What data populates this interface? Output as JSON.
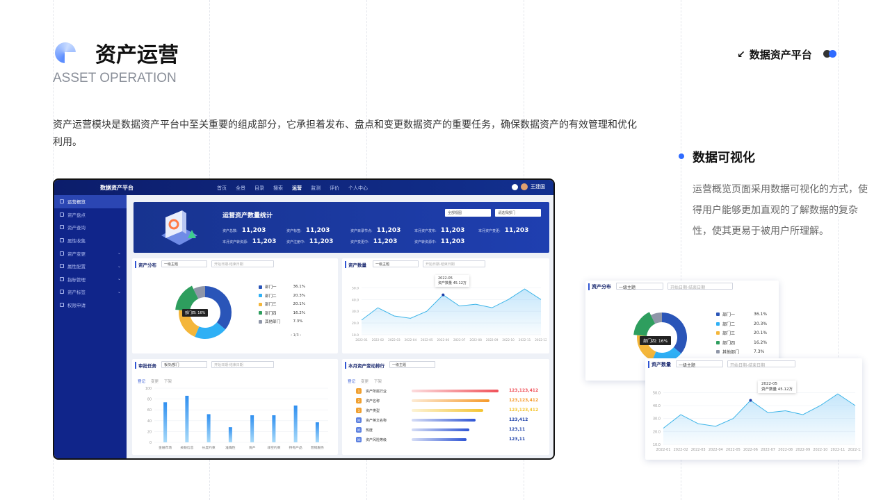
{
  "header": {
    "title": "资产运营",
    "subtitle": "ASSET OPERATION",
    "description": "资产运营模块是数据资产平台中至关重要的组成部分，它承担着发布、盘点和变更数据资产的重要任务，确保数据资产的有效管理和优化利用。",
    "brand_arrow": "↙",
    "brand": "数据资产平台",
    "dot_colors": [
      "#333333",
      "#2f6bff"
    ]
  },
  "visualization": {
    "title": "数据可视化",
    "description": "运营概览页面采用数据可视化的方式，使得用户能够更加直观的了解数据的复杂性，使其更易于被用户所理解。"
  },
  "app": {
    "name": "数据资产平台",
    "nav": [
      "首页",
      "全景",
      "目录",
      "搜索",
      "运营",
      "监测",
      "评价",
      "个人中心"
    ],
    "nav_active": 4,
    "user": "王建国",
    "sidebar": [
      {
        "label": "运营概览",
        "active": true,
        "chev": ""
      },
      {
        "label": "资产盘点",
        "chev": ""
      },
      {
        "label": "资产查询",
        "chev": ""
      },
      {
        "label": "属性收集",
        "chev": ""
      },
      {
        "label": "资产变更",
        "chev": "⌄"
      },
      {
        "label": "属性配置",
        "chev": "⌄"
      },
      {
        "label": "指标管理",
        "chev": "⌄"
      },
      {
        "label": "资产标签",
        "chev": "⌄"
      },
      {
        "label": "权限申请",
        "chev": ""
      }
    ],
    "banner": {
      "title": "运营资产数量统计",
      "select1": "全部视图",
      "select2": "请选择部门",
      "stats": [
        {
          "label": "资产总数:",
          "value": "11,203"
        },
        {
          "label": "资产标签:",
          "value": "11,203"
        },
        {
          "label": "资产目录节点:",
          "value": "11,203"
        },
        {
          "label": "本月资产发布:",
          "value": "11,203"
        },
        {
          "label": "本月资产变更:",
          "value": "11,203"
        },
        {
          "label": "本月资产转资源:",
          "value": "11,203"
        },
        {
          "label": "资产注册中:",
          "value": "11,203"
        },
        {
          "label": "资产变更中:",
          "value": "11,203"
        },
        {
          "label": "资产转资源中:",
          "value": "11,203"
        }
      ]
    },
    "dist_panel": {
      "title": "资产分布",
      "select": "一级主题",
      "date": "开始日期-结束日期",
      "tooltip": "部门四: 16%",
      "pager": "‹ 1/3 ›"
    },
    "count_panel": {
      "title": "资产数量",
      "select": "一级主题",
      "date": "开始日期-结束日期",
      "tooltip_date": "2022-05",
      "tooltip_label": "资产数量",
      "tooltip_value": "45.12万"
    },
    "task_panel": {
      "title": "审批任务",
      "select": "板块/部门",
      "date": "开始日期-结束日期",
      "tabs": [
        "登记",
        "变更",
        "下架"
      ]
    },
    "rank_panel": {
      "title": "本月资产变动排行",
      "select": "一级主题",
      "tabs": [
        "登记",
        "变更",
        "下架"
      ],
      "items": [
        {
          "badge": "1",
          "label": "资产所属行业",
          "value": "123,123,412",
          "ratio": 0.95,
          "color": "#f0525a",
          "medal": "#f0a030"
        },
        {
          "badge": "2",
          "label": "资产名称",
          "value": "123,123,412",
          "ratio": 0.85,
          "color": "#f59a2a",
          "medal": "#f0a030"
        },
        {
          "badge": "3",
          "label": "资产类型",
          "value": "123,123,412",
          "ratio": 0.78,
          "color": "#f4c430",
          "medal": "#f0a030"
        },
        {
          "badge": "04",
          "label": "资产英文名称",
          "value": "123,412",
          "ratio": 0.7,
          "color": "#2f55d4",
          "medal": "#5a7fe0"
        },
        {
          "badge": "05",
          "label": "热度",
          "value": "123,11",
          "ratio": 0.63,
          "color": "#2f55d4",
          "medal": "#5a7fe0"
        },
        {
          "badge": "06",
          "label": "资产风险等级",
          "value": "123,11",
          "ratio": 0.6,
          "color": "#2f55d4",
          "medal": "#5a7fe0"
        }
      ]
    }
  },
  "chart_data": [
    {
      "type": "pie",
      "categories": [
        "部门一",
        "部门二",
        "部门三",
        "部门四",
        "其他部门"
      ],
      "values": [
        36.1,
        20.3,
        20.1,
        16.2,
        7.3
      ],
      "labels": [
        "36.1%",
        "20.3%",
        "20.1%",
        "16.2%",
        "7.3%"
      ],
      "colors": [
        "#2a55b8",
        "#2fb0f5",
        "#f4b63a",
        "#2e9e5e",
        "#8f96a8"
      ]
    },
    {
      "type": "area",
      "x": [
        "2022-01",
        "2022-02",
        "2022-03",
        "2022-04",
        "2022-05",
        "2022-06",
        "2022-07",
        "2022-08",
        "2022-09",
        "2022-10",
        "2022-11",
        "2022-12"
      ],
      "values": [
        22.5,
        33,
        26,
        24,
        30,
        44,
        34.5,
        36,
        33,
        40,
        49,
        40
      ],
      "yticks": [
        "50.0",
        "40.0",
        "30.0",
        "20.0",
        "10.0"
      ],
      "ylim": [
        10,
        55
      ]
    },
    {
      "type": "bar",
      "categories": [
        "金融市场",
        "关联信息",
        "长度约束",
        "准确性",
        "资产",
        "非空约束",
        "持有产品",
        "营销服务"
      ],
      "values": [
        74,
        86,
        52,
        28,
        50,
        50,
        68,
        37
      ],
      "yticks": [
        "100",
        "80",
        "60",
        "40",
        "20",
        "0"
      ],
      "ylim": [
        0,
        100
      ]
    }
  ],
  "float_dist": {
    "title": "资产分布",
    "select": "一级主题",
    "date": "开始日期-结束日期",
    "tooltip": "部门四: 16%"
  },
  "float_count": {
    "title": "资产数量",
    "select": "一级主题",
    "date": "开始日期-结束日期",
    "tooltip_date": "2022-05",
    "tooltip_label": "资产数量",
    "tooltip_value": "45.12万"
  }
}
